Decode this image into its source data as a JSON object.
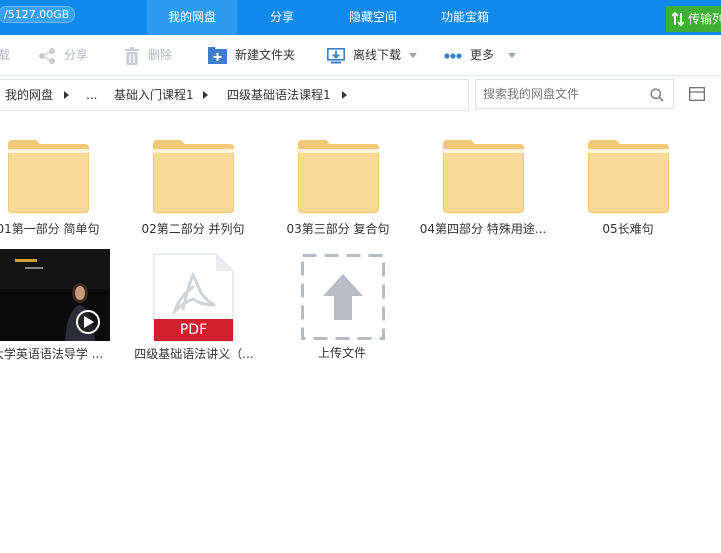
{
  "topbar": {
    "quota": "/5127.00GB",
    "nav": [
      "我的网盘",
      "分享",
      "隐藏空间",
      "功能宝箱"
    ],
    "active_index": 0,
    "transfer_label": "传输列表",
    "colors": {
      "bar": "#0f89eb",
      "active": "#2f9bf0",
      "transfer": "#3fae34"
    }
  },
  "toolbar": {
    "download_label": "载",
    "share_label": "分享",
    "delete_label": "删除",
    "new_folder_label": "新建文件夹",
    "offline_download_label": "离线下载",
    "more_label": "更多"
  },
  "breadcrumb": [
    "我的网盘",
    "...",
    "基础入门课程1",
    "四级基础语法课程1"
  ],
  "search": {
    "placeholder": "搜索我的网盘文件"
  },
  "items": [
    {
      "type": "folder",
      "label": "01第一部分 简单句"
    },
    {
      "type": "folder",
      "label": "02第二部分 并列句"
    },
    {
      "type": "folder",
      "label": "03第三部分 复合句"
    },
    {
      "type": "folder",
      "label": "04第四部分 特殊用途..."
    },
    {
      "type": "folder",
      "label": "05长难句"
    },
    {
      "type": "video",
      "label": "大学英语语法导学 ..."
    },
    {
      "type": "pdf",
      "label": "四级基础语法讲义（...",
      "badge": "PDF"
    },
    {
      "type": "upload",
      "label": "上传文件"
    }
  ]
}
